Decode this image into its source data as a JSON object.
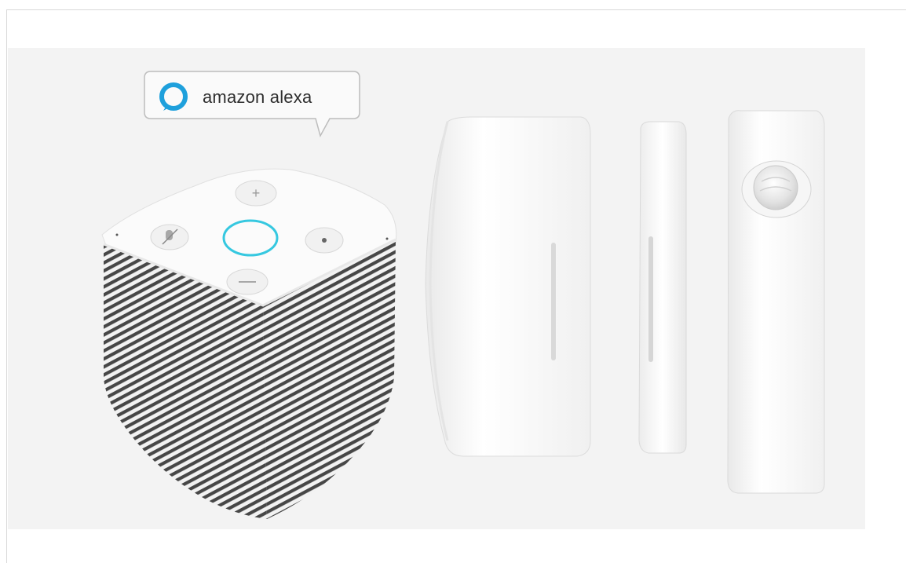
{
  "badge": {
    "brand_text": "amazon alexa",
    "ring_color": "#1ea0dc"
  },
  "devices": [
    {
      "name": "smart-speaker"
    },
    {
      "name": "door-sensor-main"
    },
    {
      "name": "door-sensor-magnet"
    },
    {
      "name": "motion-sensor"
    }
  ],
  "colors": {
    "photo_background": "#f3f3f3",
    "device_white": "#fbfbfb",
    "grille_dark": "#4a4a4a",
    "light_ring": "#36c8e0"
  }
}
